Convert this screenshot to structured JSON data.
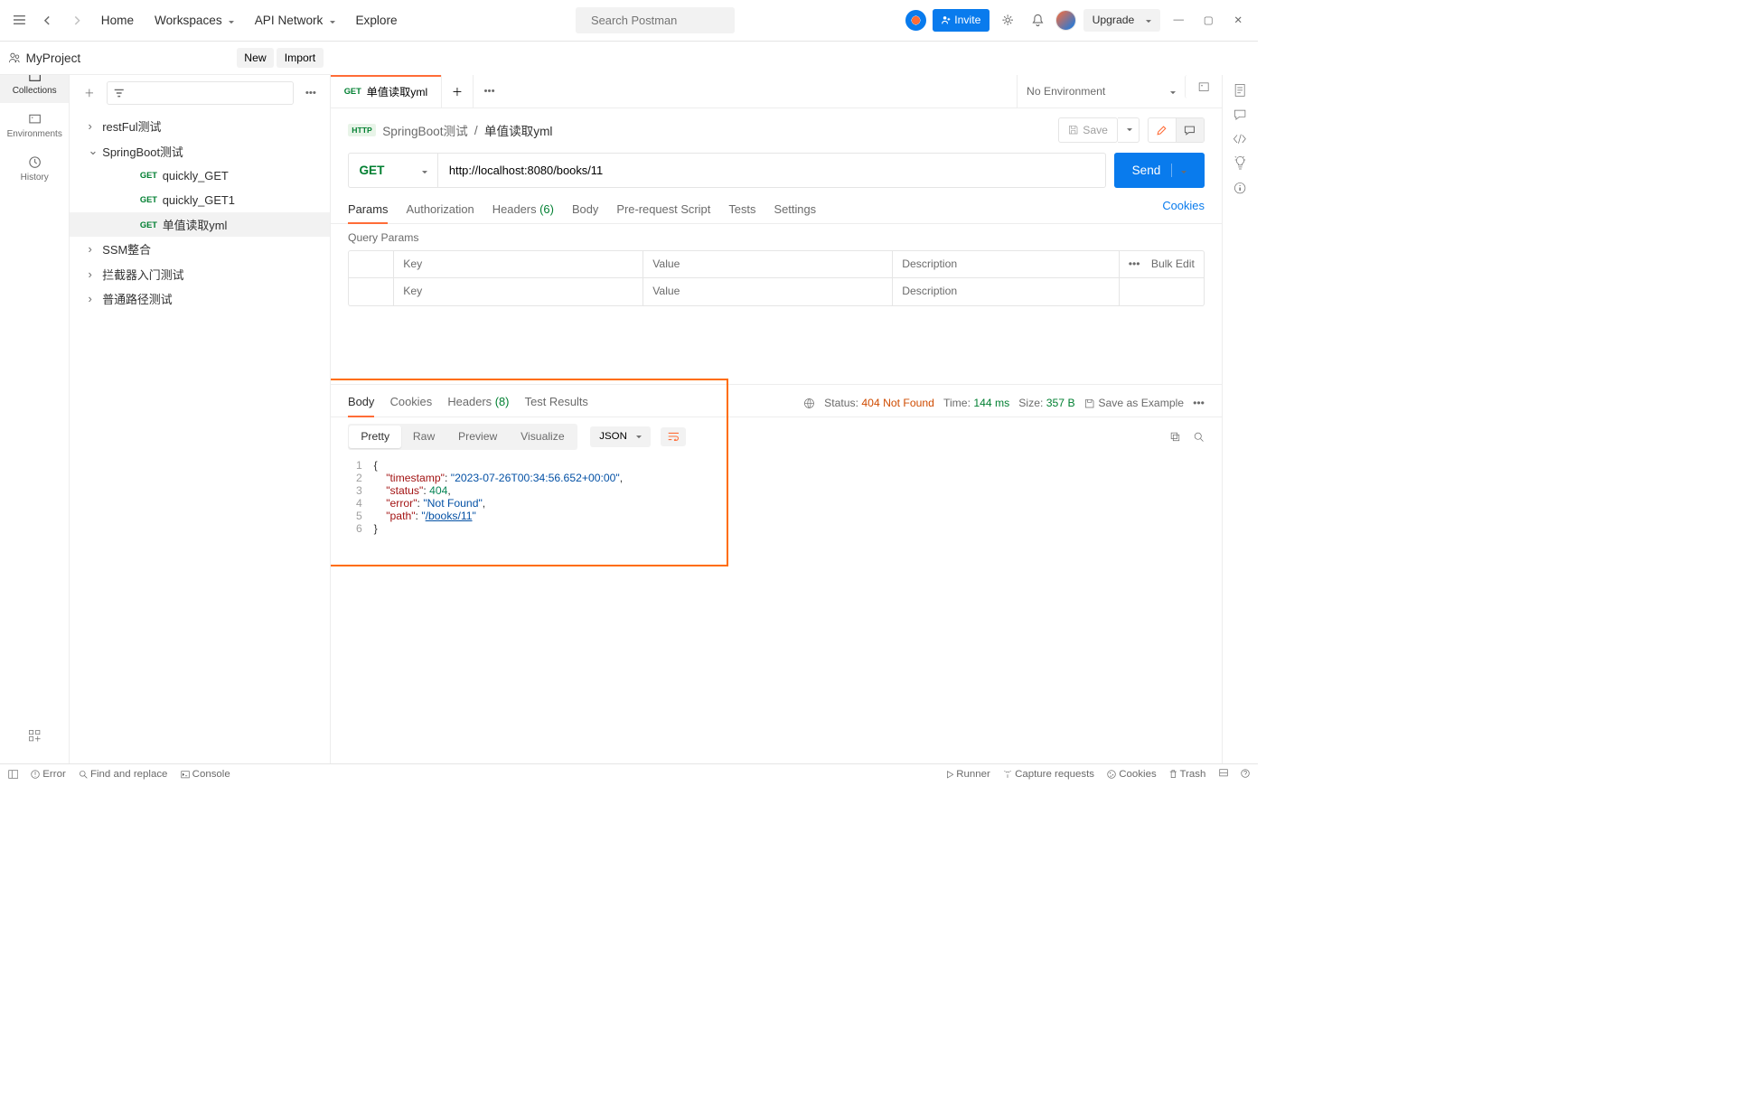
{
  "topbar": {
    "home": "Home",
    "workspaces": "Workspaces",
    "api_network": "API Network",
    "explore": "Explore",
    "search_placeholder": "Search Postman",
    "invite": "Invite",
    "upgrade": "Upgrade"
  },
  "workspace": {
    "name": "MyProject",
    "new_btn": "New",
    "import_btn": "Import"
  },
  "rail": {
    "collections": "Collections",
    "environments": "Environments",
    "history": "History"
  },
  "tree": [
    {
      "label": "restFul测试",
      "expanded": false,
      "indent": 1
    },
    {
      "label": "SpringBoot测试",
      "expanded": true,
      "indent": 1
    },
    {
      "label": "quickly_GET",
      "method": "GET",
      "indent": 2
    },
    {
      "label": "quickly_GET1",
      "method": "GET",
      "indent": 2
    },
    {
      "label": "单值读取yml",
      "method": "GET",
      "indent": 2,
      "selected": true
    },
    {
      "label": "SSM整合",
      "expanded": false,
      "indent": 1
    },
    {
      "label": "拦截器入门测试",
      "expanded": false,
      "indent": 1
    },
    {
      "label": "普通路径测试",
      "expanded": false,
      "indent": 1
    }
  ],
  "tabs": {
    "active_method": "GET",
    "active_label": "单值读取yml",
    "env": "No Environment"
  },
  "breadcrumb": {
    "collection": "SpringBoot测试",
    "request": "单值读取yml",
    "save": "Save"
  },
  "request": {
    "method": "GET",
    "url": "http://localhost:8080/books/11",
    "send": "Send",
    "tabs": {
      "params": "Params",
      "auth": "Authorization",
      "headers": "Headers",
      "headers_count": "(6)",
      "body": "Body",
      "prereq": "Pre-request Script",
      "tests": "Tests",
      "settings": "Settings",
      "cookies": "Cookies"
    },
    "query_params_label": "Query Params",
    "table": {
      "h_key": "Key",
      "h_value": "Value",
      "h_desc": "Description",
      "bulk": "Bulk Edit",
      "ph_key": "Key",
      "ph_value": "Value",
      "ph_desc": "Description"
    }
  },
  "response": {
    "tabs": {
      "body": "Body",
      "cookies": "Cookies",
      "headers": "Headers",
      "headers_count": "(8)",
      "tests": "Test Results"
    },
    "status_label": "Status:",
    "status_value": "404 Not Found",
    "time_label": "Time:",
    "time_value": "144 ms",
    "size_label": "Size:",
    "size_value": "357 B",
    "save_example": "Save as Example",
    "view": {
      "pretty": "Pretty",
      "raw": "Raw",
      "preview": "Preview",
      "visualize": "Visualize",
      "format": "JSON"
    },
    "body_json": {
      "timestamp": "2023-07-26T00:34:56.652+00:00",
      "status": 404,
      "error": "Not Found",
      "path": "/books/11"
    }
  },
  "statusbar": {
    "error": "Error",
    "find": "Find and replace",
    "console": "Console",
    "runner": "Runner",
    "capture": "Capture requests",
    "cookies": "Cookies",
    "trash": "Trash"
  }
}
